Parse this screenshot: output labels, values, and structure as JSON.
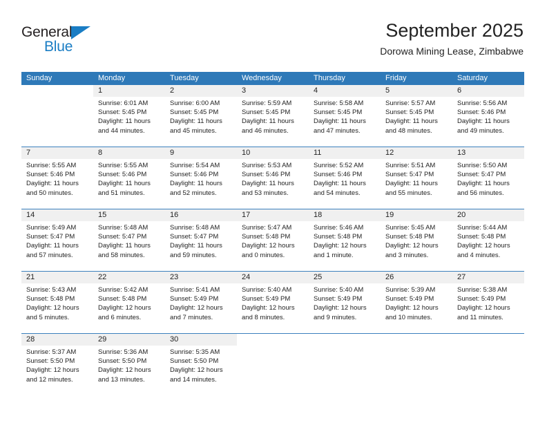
{
  "brand": {
    "name_top": "General",
    "name_bottom": "Blue",
    "color_black": "#231f20",
    "color_blue": "#1a7dc4"
  },
  "header": {
    "title": "September 2025",
    "subtitle": "Dorowa Mining Lease, Zimbabwe"
  },
  "theme": {
    "header_blue": "#2e79b8",
    "rule_blue": "#3a7fbd",
    "daynum_gray": "#f0f0f0"
  },
  "weekdays": [
    "Sunday",
    "Monday",
    "Tuesday",
    "Wednesday",
    "Thursday",
    "Friday",
    "Saturday"
  ],
  "weeks": [
    [
      {
        "day": "",
        "blank": true
      },
      {
        "day": "1",
        "sunrise": "Sunrise: 6:01 AM",
        "sunset": "Sunset: 5:45 PM",
        "daylight": "Daylight: 11 hours and 44 minutes."
      },
      {
        "day": "2",
        "sunrise": "Sunrise: 6:00 AM",
        "sunset": "Sunset: 5:45 PM",
        "daylight": "Daylight: 11 hours and 45 minutes."
      },
      {
        "day": "3",
        "sunrise": "Sunrise: 5:59 AM",
        "sunset": "Sunset: 5:45 PM",
        "daylight": "Daylight: 11 hours and 46 minutes."
      },
      {
        "day": "4",
        "sunrise": "Sunrise: 5:58 AM",
        "sunset": "Sunset: 5:45 PM",
        "daylight": "Daylight: 11 hours and 47 minutes."
      },
      {
        "day": "5",
        "sunrise": "Sunrise: 5:57 AM",
        "sunset": "Sunset: 5:45 PM",
        "daylight": "Daylight: 11 hours and 48 minutes."
      },
      {
        "day": "6",
        "sunrise": "Sunrise: 5:56 AM",
        "sunset": "Sunset: 5:46 PM",
        "daylight": "Daylight: 11 hours and 49 minutes."
      }
    ],
    [
      {
        "day": "7",
        "sunrise": "Sunrise: 5:55 AM",
        "sunset": "Sunset: 5:46 PM",
        "daylight": "Daylight: 11 hours and 50 minutes."
      },
      {
        "day": "8",
        "sunrise": "Sunrise: 5:55 AM",
        "sunset": "Sunset: 5:46 PM",
        "daylight": "Daylight: 11 hours and 51 minutes."
      },
      {
        "day": "9",
        "sunrise": "Sunrise: 5:54 AM",
        "sunset": "Sunset: 5:46 PM",
        "daylight": "Daylight: 11 hours and 52 minutes."
      },
      {
        "day": "10",
        "sunrise": "Sunrise: 5:53 AM",
        "sunset": "Sunset: 5:46 PM",
        "daylight": "Daylight: 11 hours and 53 minutes."
      },
      {
        "day": "11",
        "sunrise": "Sunrise: 5:52 AM",
        "sunset": "Sunset: 5:46 PM",
        "daylight": "Daylight: 11 hours and 54 minutes."
      },
      {
        "day": "12",
        "sunrise": "Sunrise: 5:51 AM",
        "sunset": "Sunset: 5:47 PM",
        "daylight": "Daylight: 11 hours and 55 minutes."
      },
      {
        "day": "13",
        "sunrise": "Sunrise: 5:50 AM",
        "sunset": "Sunset: 5:47 PM",
        "daylight": "Daylight: 11 hours and 56 minutes."
      }
    ],
    [
      {
        "day": "14",
        "sunrise": "Sunrise: 5:49 AM",
        "sunset": "Sunset: 5:47 PM",
        "daylight": "Daylight: 11 hours and 57 minutes."
      },
      {
        "day": "15",
        "sunrise": "Sunrise: 5:48 AM",
        "sunset": "Sunset: 5:47 PM",
        "daylight": "Daylight: 11 hours and 58 minutes."
      },
      {
        "day": "16",
        "sunrise": "Sunrise: 5:48 AM",
        "sunset": "Sunset: 5:47 PM",
        "daylight": "Daylight: 11 hours and 59 minutes."
      },
      {
        "day": "17",
        "sunrise": "Sunrise: 5:47 AM",
        "sunset": "Sunset: 5:48 PM",
        "daylight": "Daylight: 12 hours and 0 minutes."
      },
      {
        "day": "18",
        "sunrise": "Sunrise: 5:46 AM",
        "sunset": "Sunset: 5:48 PM",
        "daylight": "Daylight: 12 hours and 1 minute."
      },
      {
        "day": "19",
        "sunrise": "Sunrise: 5:45 AM",
        "sunset": "Sunset: 5:48 PM",
        "daylight": "Daylight: 12 hours and 3 minutes."
      },
      {
        "day": "20",
        "sunrise": "Sunrise: 5:44 AM",
        "sunset": "Sunset: 5:48 PM",
        "daylight": "Daylight: 12 hours and 4 minutes."
      }
    ],
    [
      {
        "day": "21",
        "sunrise": "Sunrise: 5:43 AM",
        "sunset": "Sunset: 5:48 PM",
        "daylight": "Daylight: 12 hours and 5 minutes."
      },
      {
        "day": "22",
        "sunrise": "Sunrise: 5:42 AM",
        "sunset": "Sunset: 5:48 PM",
        "daylight": "Daylight: 12 hours and 6 minutes."
      },
      {
        "day": "23",
        "sunrise": "Sunrise: 5:41 AM",
        "sunset": "Sunset: 5:49 PM",
        "daylight": "Daylight: 12 hours and 7 minutes."
      },
      {
        "day": "24",
        "sunrise": "Sunrise: 5:40 AM",
        "sunset": "Sunset: 5:49 PM",
        "daylight": "Daylight: 12 hours and 8 minutes."
      },
      {
        "day": "25",
        "sunrise": "Sunrise: 5:40 AM",
        "sunset": "Sunset: 5:49 PM",
        "daylight": "Daylight: 12 hours and 9 minutes."
      },
      {
        "day": "26",
        "sunrise": "Sunrise: 5:39 AM",
        "sunset": "Sunset: 5:49 PM",
        "daylight": "Daylight: 12 hours and 10 minutes."
      },
      {
        "day": "27",
        "sunrise": "Sunrise: 5:38 AM",
        "sunset": "Sunset: 5:49 PM",
        "daylight": "Daylight: 12 hours and 11 minutes."
      }
    ],
    [
      {
        "day": "28",
        "sunrise": "Sunrise: 5:37 AM",
        "sunset": "Sunset: 5:50 PM",
        "daylight": "Daylight: 12 hours and 12 minutes."
      },
      {
        "day": "29",
        "sunrise": "Sunrise: 5:36 AM",
        "sunset": "Sunset: 5:50 PM",
        "daylight": "Daylight: 12 hours and 13 minutes."
      },
      {
        "day": "30",
        "sunrise": "Sunrise: 5:35 AM",
        "sunset": "Sunset: 5:50 PM",
        "daylight": "Daylight: 12 hours and 14 minutes."
      },
      {
        "day": "",
        "blank": true
      },
      {
        "day": "",
        "blank": true
      },
      {
        "day": "",
        "blank": true
      },
      {
        "day": "",
        "blank": true
      }
    ]
  ]
}
